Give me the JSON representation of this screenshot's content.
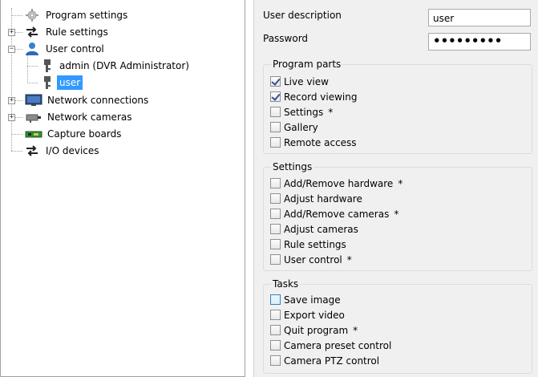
{
  "tree": {
    "items": [
      {
        "label": "Program settings",
        "icon": "gear-icon"
      },
      {
        "label": "Rule settings",
        "icon": "exchange-arrows-icon"
      },
      {
        "label": "User control",
        "icon": "user-icon"
      },
      {
        "label": "admin (DVR Administrator)",
        "icon": "key-icon"
      },
      {
        "label": "user",
        "icon": "key-icon",
        "selected": true
      },
      {
        "label": "Network connections",
        "icon": "monitor-icon"
      },
      {
        "label": "Network cameras",
        "icon": "camera-icon"
      },
      {
        "label": "Capture boards",
        "icon": "capture-board-icon"
      },
      {
        "label": "I/O devices",
        "icon": "exchange-arrows-icon"
      }
    ]
  },
  "form": {
    "description_label": "User description",
    "description_value": "user",
    "password_label": "Password",
    "password_value": "•••••••••"
  },
  "groups": {
    "program_parts": {
      "title": "Program parts",
      "items": [
        {
          "label": "Live view",
          "checked": true,
          "mark": ""
        },
        {
          "label": "Record viewing",
          "checked": true,
          "mark": ""
        },
        {
          "label": "Settings",
          "checked": false,
          "mark": "*"
        },
        {
          "label": "Gallery",
          "checked": false,
          "mark": ""
        },
        {
          "label": "Remote access",
          "checked": false,
          "mark": ""
        }
      ]
    },
    "settings": {
      "title": "Settings",
      "items": [
        {
          "label": "Add/Remove hardware",
          "checked": false,
          "mark": "*"
        },
        {
          "label": "Adjust hardware",
          "checked": false,
          "mark": ""
        },
        {
          "label": "Add/Remove cameras",
          "checked": false,
          "mark": "*"
        },
        {
          "label": "Adjust cameras",
          "checked": false,
          "mark": ""
        },
        {
          "label": "Rule settings",
          "checked": false,
          "mark": ""
        },
        {
          "label": "User control",
          "checked": false,
          "mark": "*"
        }
      ]
    },
    "tasks": {
      "title": "Tasks",
      "items": [
        {
          "label": "Save image",
          "checked": false,
          "mark": "",
          "hover": true
        },
        {
          "label": "Export video",
          "checked": false,
          "mark": ""
        },
        {
          "label": "Quit program",
          "checked": false,
          "mark": "*"
        },
        {
          "label": "Camera preset control",
          "checked": false,
          "mark": ""
        },
        {
          "label": "Camera PTZ control",
          "checked": false,
          "mark": ""
        }
      ]
    }
  },
  "colors": {
    "selection": "#3399ff",
    "check": "#3b4b9b",
    "panel_bg": "#f0f0f0"
  }
}
